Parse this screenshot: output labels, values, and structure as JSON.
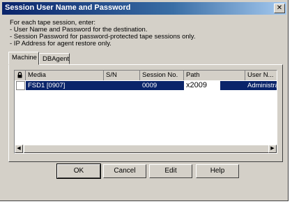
{
  "window": {
    "title": "Session User Name and Password",
    "close_glyph": "✕"
  },
  "instructions": [
    "For each tape session, enter:",
    "- User Name and Password for the destination.",
    "- Session Password for password-protected tape sessions only.",
    "- IP Address for agent restore only."
  ],
  "tabs": [
    {
      "label": "Machine",
      "active": true
    },
    {
      "label": "DBAgent",
      "active": false
    }
  ],
  "table": {
    "lock_icon": "lock-icon",
    "columns": [
      "Media",
      "S/N",
      "Session No.",
      "Path",
      "User N..."
    ],
    "rows": [
      {
        "media": "FSD1 [0907]",
        "sn": "",
        "session_no": "0009",
        "path": "x2009",
        "user": "Administra"
      }
    ]
  },
  "buttons": {
    "ok": "OK",
    "cancel": "Cancel",
    "edit": "Edit",
    "help": "Help"
  },
  "colors": {
    "selection": "#0a246a",
    "face": "#d4d0c8",
    "title_start": "#0a246a"
  }
}
